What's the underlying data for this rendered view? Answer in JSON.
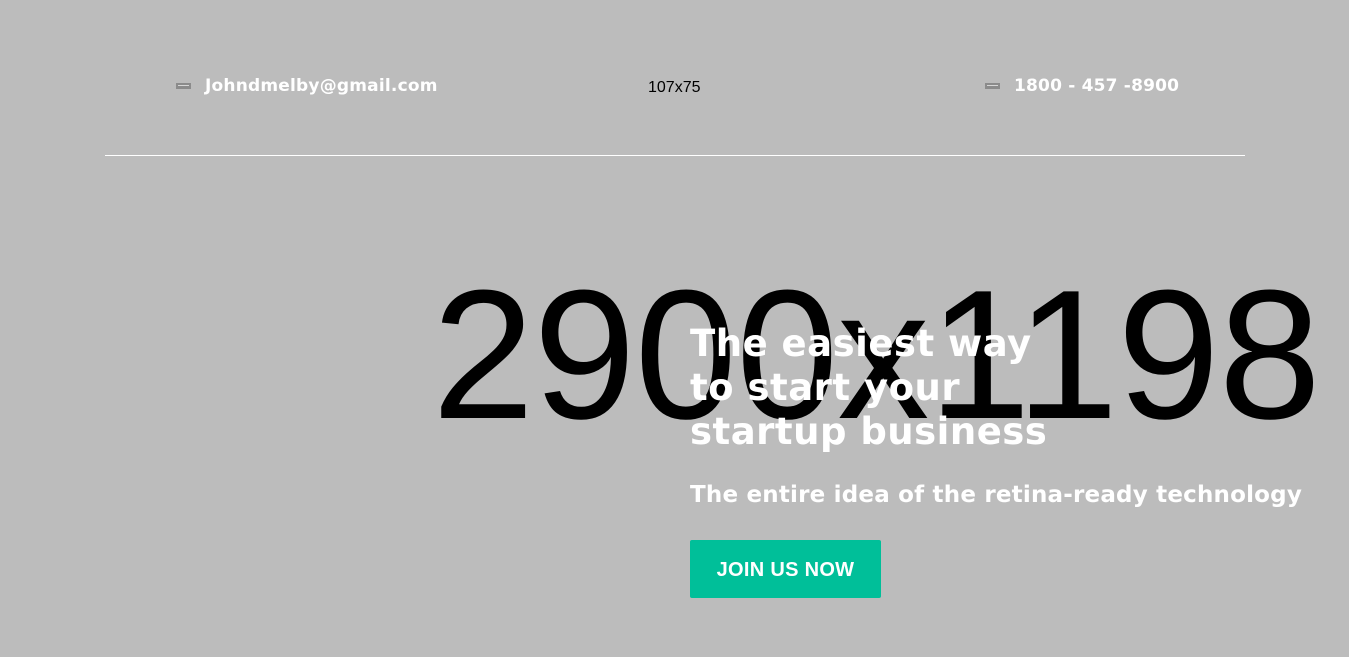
{
  "header": {
    "email": "Johndmelby@gmail.com",
    "logo_placeholder": "107x75",
    "phone": "1800 - 457 -8900"
  },
  "icons": {
    "email": "mail-icon",
    "phone": "phone-icon"
  },
  "hero": {
    "image_placeholder": "2900x1198",
    "title": "The easiest way to start your startup business",
    "subtitle": "The entire idea of the retina-ready technology",
    "cta_label": "JOIN US NOW"
  },
  "colors": {
    "background": "#bcbcbc",
    "accent": "#00bf99",
    "text_light": "#ffffff",
    "placeholder_text": "#000000"
  }
}
